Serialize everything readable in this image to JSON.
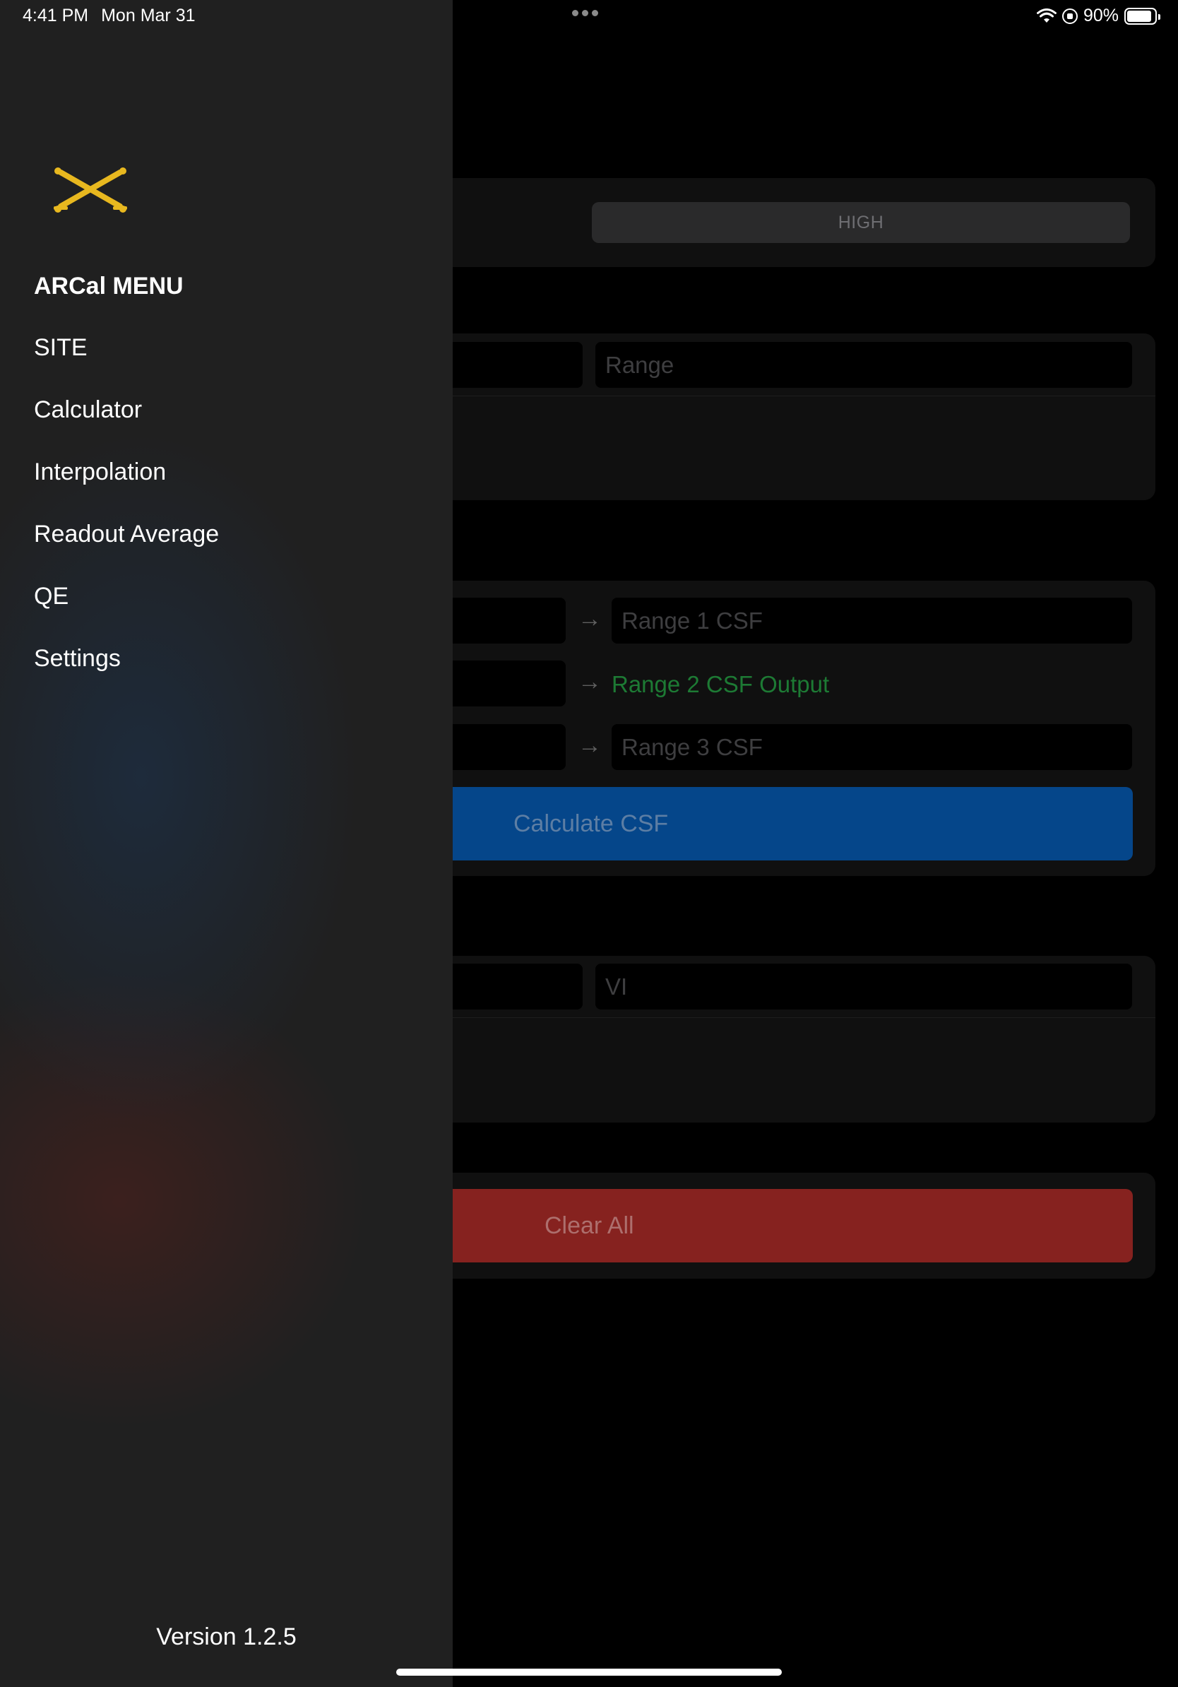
{
  "status_bar": {
    "time": "4:41 PM",
    "date": "Mon Mar 31",
    "battery": "90%",
    "battery_level": 0.9
  },
  "drawer": {
    "title": "ARCal MENU",
    "items": [
      {
        "label": "SITE"
      },
      {
        "label": "Calculator"
      },
      {
        "label": "Interpolation"
      },
      {
        "label": "Readout Average"
      },
      {
        "label": "QE"
      },
      {
        "label": "Settings"
      }
    ],
    "version": "Version 1.2.5"
  },
  "main": {
    "segment_high": "HIGH",
    "range_placeholder": "Range",
    "range1_csf_placeholder": "Range 1 CSF",
    "range2_csf_output": "Range 2 CSF Output",
    "range3_csf_placeholder": "Range 3 CSF",
    "arrow": "→",
    "calculate_button": "Calculate CSF",
    "vi_placeholder": "VI",
    "clear_button": "Clear All"
  },
  "colors": {
    "accent_blue": "#05468a",
    "danger_red": "#86221f",
    "output_green": "#1d7a34",
    "insignia_gold": "#e8b81f"
  }
}
